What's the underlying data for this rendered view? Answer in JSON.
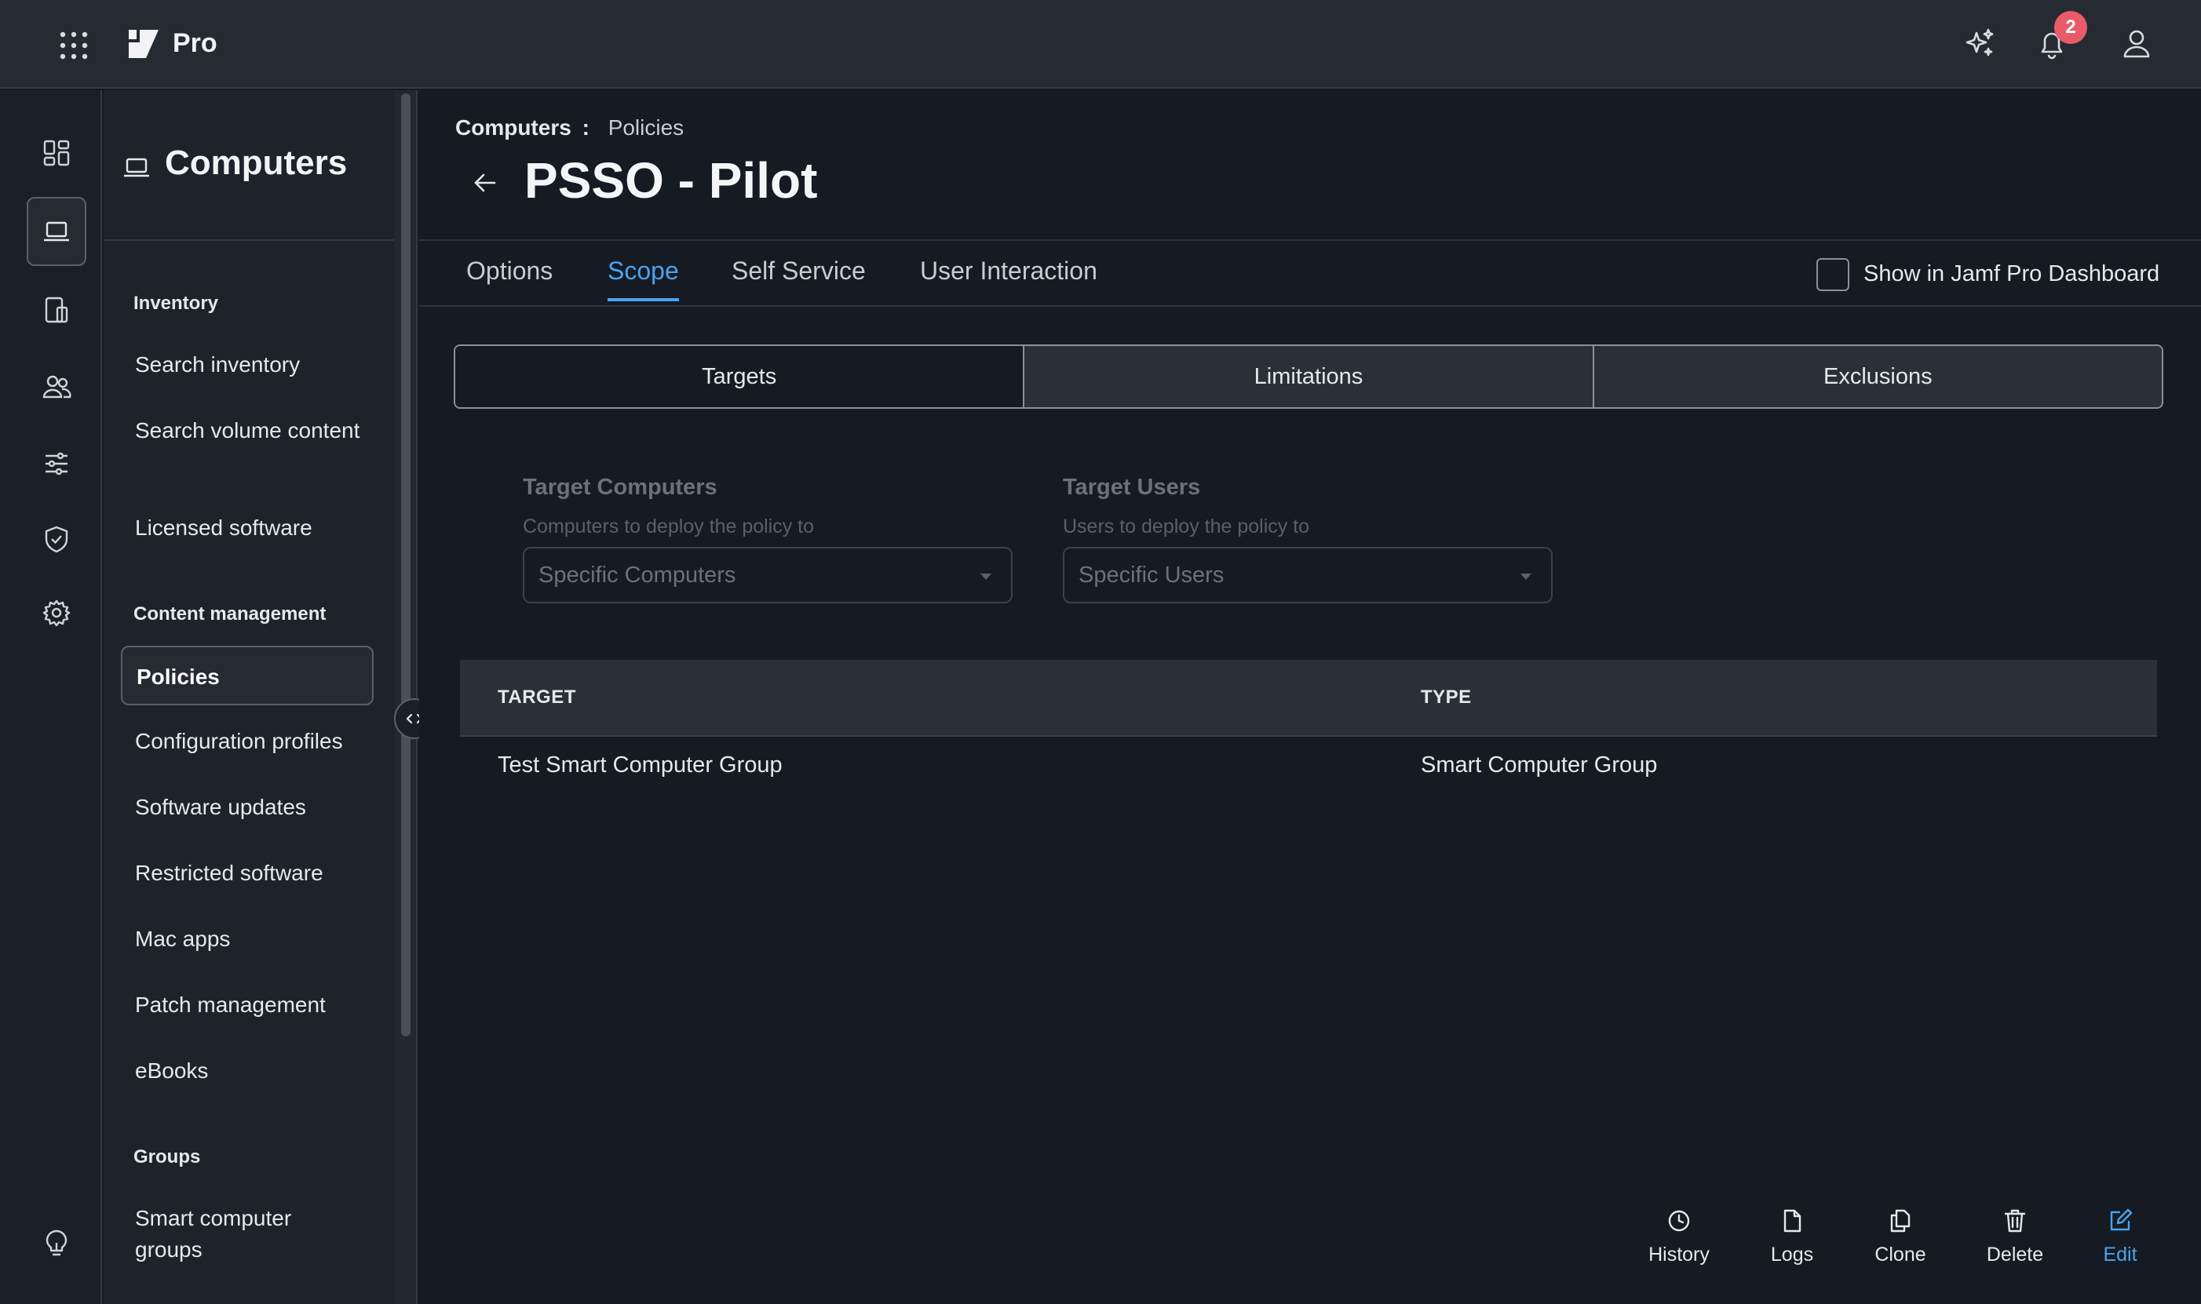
{
  "app": {
    "product_name": "Pro",
    "notification_count": "2"
  },
  "rail": {
    "items": [
      {
        "icon": "dashboard-icon"
      },
      {
        "icon": "laptop-icon",
        "active": true
      },
      {
        "icon": "devices-icon"
      },
      {
        "icon": "users-icon"
      },
      {
        "icon": "sliders-icon"
      },
      {
        "icon": "shield-icon"
      },
      {
        "icon": "gear-icon"
      }
    ],
    "bottom_icon": "lightbulb-icon"
  },
  "sidenav": {
    "title": "Computers",
    "sections": {
      "inventory": "Inventory",
      "content_management": "Content management",
      "groups": "Groups"
    },
    "links": {
      "search_inventory": "Search inventory",
      "search_volume_content": "Search volume content",
      "licensed_software": "Licensed software",
      "policies": "Policies",
      "configuration_profiles": "Configuration profiles",
      "software_updates": "Software updates",
      "restricted_software": "Restricted software",
      "mac_apps": "Mac apps",
      "patch_management": "Patch management",
      "ebooks": "eBooks",
      "smart_computer_groups": "Smart computer groups"
    }
  },
  "breadcrumb": {
    "root": "Computers",
    "separator": ":",
    "current": "Policies"
  },
  "page": {
    "title": "PSSO - Pilot"
  },
  "tabs": {
    "options": "Options",
    "scope": "Scope",
    "self_service": "Self Service",
    "user_interaction": "User Interaction",
    "active": "Scope"
  },
  "dashboard_toggle": {
    "label": "Show in Jamf Pro Dashboard",
    "checked": false
  },
  "scope_tabs": {
    "targets": "Targets",
    "limitations": "Limitations",
    "exclusions": "Exclusions"
  },
  "target_computers": {
    "label": "Target Computers",
    "help": "Computers to deploy the policy to",
    "value": "Specific Computers"
  },
  "target_users": {
    "label": "Target Users",
    "help": "Users to deploy the policy to",
    "value": "Specific Users"
  },
  "table": {
    "headers": {
      "target": "TARGET",
      "type": "TYPE"
    },
    "rows": [
      {
        "target": "Test Smart Computer Group",
        "type": "Smart Computer Group"
      }
    ]
  },
  "actions": {
    "history": "History",
    "logs": "Logs",
    "clone": "Clone",
    "delete": "Delete",
    "edit": "Edit"
  },
  "colors": {
    "accent": "#4aa3f0",
    "badge": "#e85c6a",
    "background": "#161a22"
  }
}
